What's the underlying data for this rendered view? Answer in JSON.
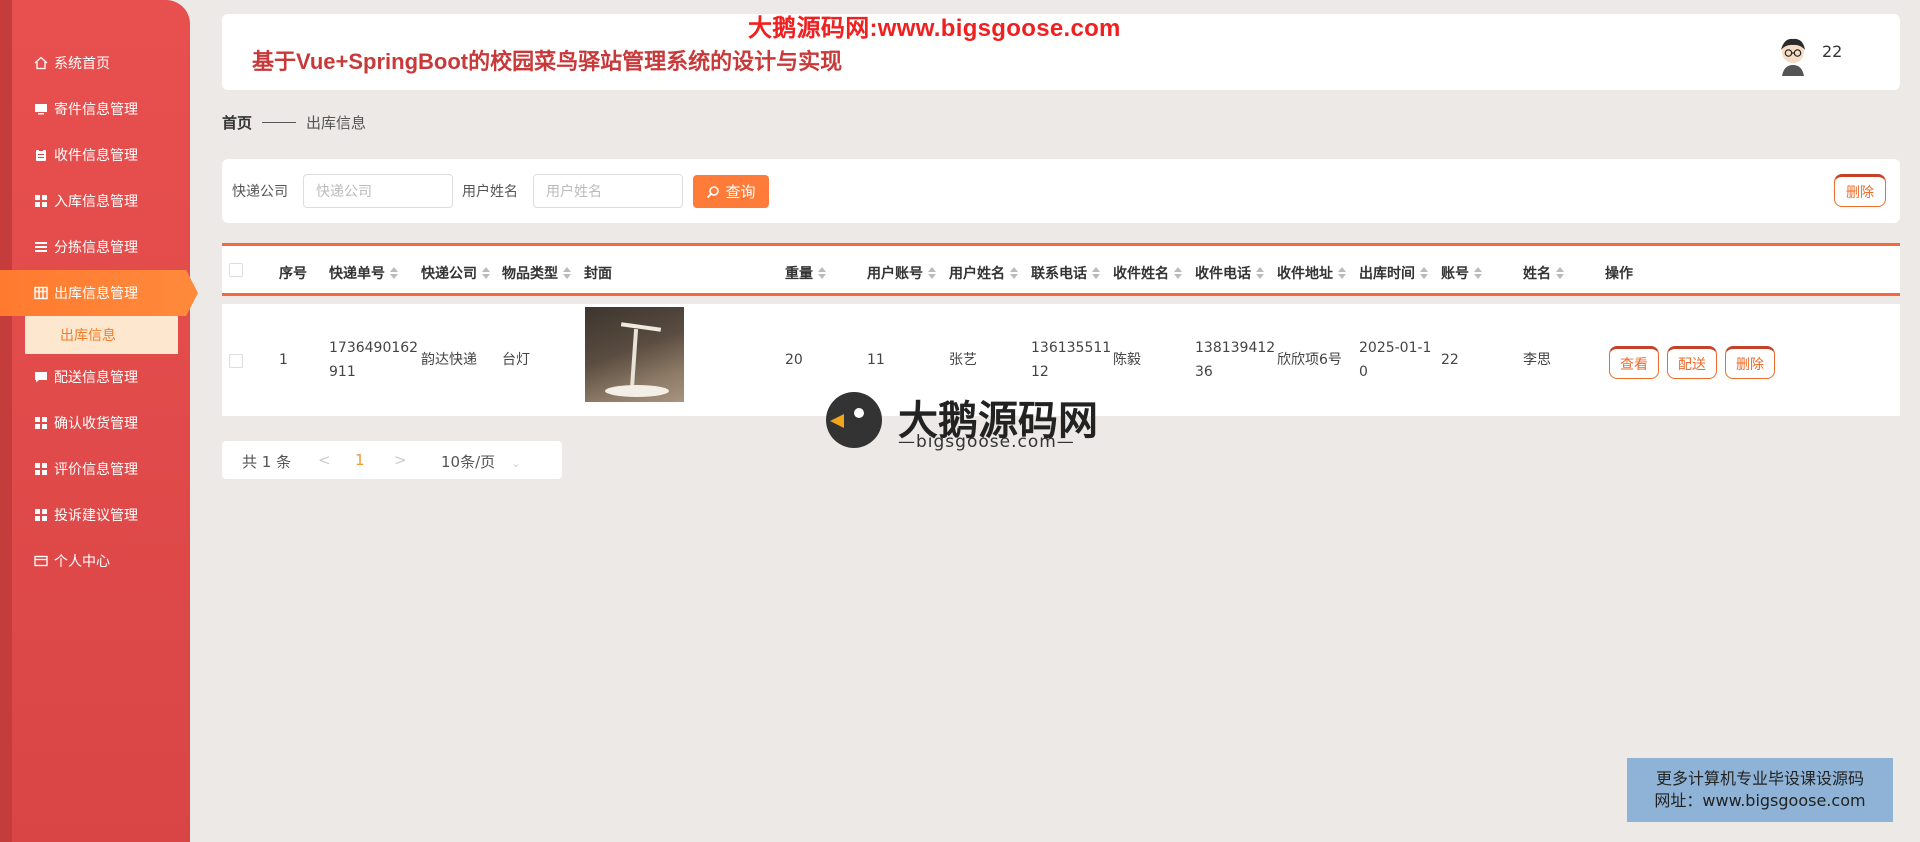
{
  "watermark": {
    "top": "大鹅源码网:www.bigsgoose.com",
    "logo_text": "大鹅源码网",
    "logo_sub": "—bigsgoose.com—",
    "box_line1": "更多计算机专业毕设课设源码",
    "box_line2": "网址：www.bigsgoose.com"
  },
  "header": {
    "title": "基于Vue+SpringBoot的校园菜鸟驿站管理系统的设计与实现",
    "user": "22"
  },
  "sidebar": {
    "items": [
      {
        "label": "系统首页",
        "icon": "home-icon"
      },
      {
        "label": "寄件信息管理",
        "icon": "monitor-icon"
      },
      {
        "label": "收件信息管理",
        "icon": "clipboard-icon"
      },
      {
        "label": "入库信息管理",
        "icon": "grid-icon"
      },
      {
        "label": "分拣信息管理",
        "icon": "list-icon"
      },
      {
        "label": "出库信息管理",
        "icon": "table-icon"
      },
      {
        "label": "配送信息管理",
        "icon": "chat-icon"
      },
      {
        "label": "确认收货管理",
        "icon": "grid-icon"
      },
      {
        "label": "评价信息管理",
        "icon": "grid-icon"
      },
      {
        "label": "投诉建议管理",
        "icon": "grid-icon"
      },
      {
        "label": "个人中心",
        "icon": "card-icon"
      }
    ],
    "sub_item": "出库信息"
  },
  "breadcrumb": {
    "home": "首页",
    "current": "出库信息"
  },
  "search": {
    "company_label": "快递公司",
    "company_placeholder": "快递公司",
    "user_label": "用户姓名",
    "user_placeholder": "用户姓名",
    "query_button": "查询",
    "delete_button": "删除"
  },
  "table": {
    "columns": [
      "序号",
      "快递单号",
      "快递公司",
      "物品类型",
      "封面",
      "重量",
      "用户账号",
      "用户姓名",
      "联系电话",
      "收件姓名",
      "收件电话",
      "收件地址",
      "出库时间",
      "账号",
      "姓名",
      "操作"
    ],
    "row": {
      "index": "1",
      "tracking_no_line1": "1736490162",
      "tracking_no_line2": "911",
      "company": "韵达快递",
      "item_type": "台灯",
      "weight": "20",
      "user_account": "11",
      "user_name": "张艺",
      "phone_line1": "136135511",
      "phone_line2": "12",
      "receiver_name": "陈毅",
      "receiver_phone_line1": "138139412",
      "receiver_phone_line2": "36",
      "address": "欣欣项6号",
      "out_time_line1": "2025-01-1",
      "out_time_line2": "0",
      "account": "22",
      "name": "李思"
    },
    "actions": {
      "view": "查看",
      "deliver": "配送",
      "delete": "删除"
    }
  },
  "pagination": {
    "total": "共 1 条",
    "prev": "<",
    "page": "1",
    "next": ">",
    "page_size": "10条/页"
  }
}
